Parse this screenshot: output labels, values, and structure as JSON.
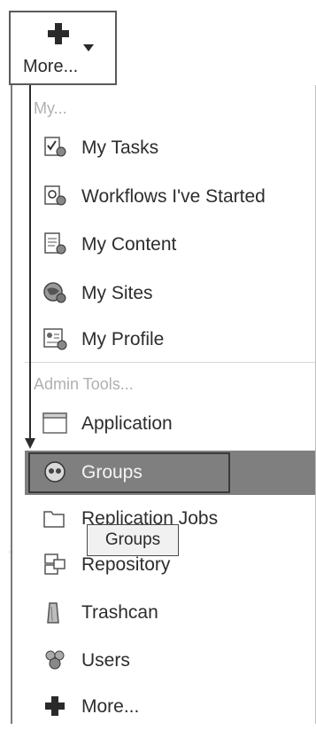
{
  "more_button": {
    "label": "More..."
  },
  "menu": {
    "my_section": {
      "label": "My...",
      "items": [
        {
          "label": "My Tasks",
          "icon": "tasks-icon"
        },
        {
          "label": "Workflows I've Started",
          "icon": "workflow-icon"
        },
        {
          "label": "My Content",
          "icon": "content-icon"
        },
        {
          "label": "My Sites",
          "icon": "sites-icon"
        },
        {
          "label": "My Profile",
          "icon": "profile-icon"
        }
      ]
    },
    "admin_section": {
      "label": "Admin Tools...",
      "items": [
        {
          "label": "Application",
          "icon": "application-icon"
        },
        {
          "label": "Groups",
          "icon": "groups-icon",
          "selected": true
        },
        {
          "label": "Replication Jobs",
          "icon": "folder-icon"
        },
        {
          "label": "Repository",
          "icon": "repository-icon"
        },
        {
          "label": "Trashcan",
          "icon": "trashcan-icon"
        },
        {
          "label": "Users",
          "icon": "users-icon"
        },
        {
          "label": "More...",
          "icon": "plus-icon"
        }
      ]
    }
  },
  "tooltip": {
    "text": "Groups"
  },
  "colors": {
    "selected_bg": "#7f7f7f",
    "section_label": "#b0b0b0",
    "text": "#2d2d2d"
  }
}
